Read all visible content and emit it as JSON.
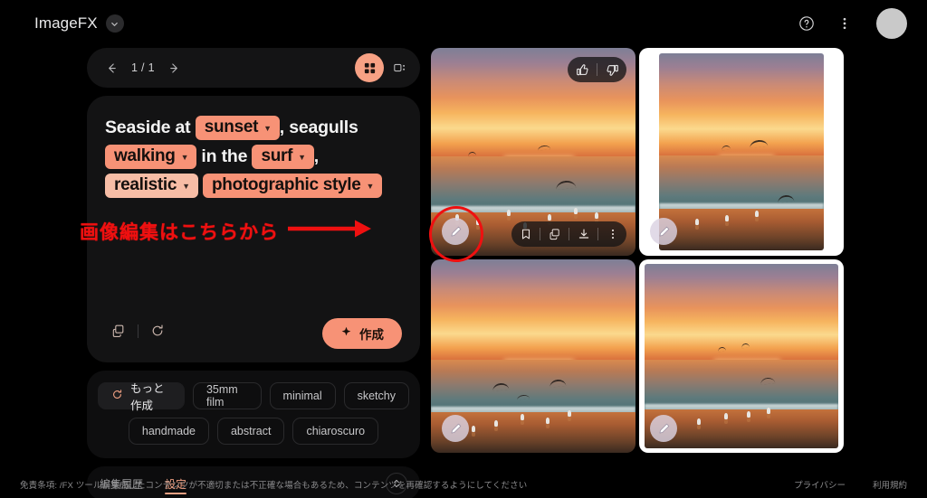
{
  "header": {
    "brand": "ImageFX",
    "brand_caret_icon": "chevron-down-icon",
    "help_icon": "help-circle-icon",
    "menu_icon": "more-vertical-icon",
    "avatar_icon": "avatar"
  },
  "pager": {
    "prev_icon": "arrow-left-icon",
    "next_icon": "arrow-right-icon",
    "count": "1 / 1",
    "grid_view_icon": "grid-view-icon",
    "detail_view_icon": "detail-view-icon"
  },
  "prompt": {
    "segments": [
      {
        "type": "text",
        "value": "Seaside at "
      },
      {
        "type": "chip",
        "value": "sunset",
        "style": "solid"
      },
      {
        "type": "text",
        "value": ", seagulls"
      },
      {
        "type": "chip",
        "value": "walking",
        "style": "solid"
      },
      {
        "type": "text",
        "value": " in the "
      },
      {
        "type": "chip",
        "value": "surf",
        "style": "solid"
      },
      {
        "type": "text",
        "value": ","
      },
      {
        "type": "chip",
        "value": "realistic",
        "style": "light"
      },
      {
        "type": "chip",
        "value": "photographic style",
        "style": "solid"
      }
    ],
    "line1_prefix": "Seaside at ",
    "chip_sunset": "sunset",
    "line1_suffix": ", seagulls",
    "chip_walking": "walking",
    "line2_mid": " in the ",
    "chip_surf": "surf",
    "line2_suffix": ",",
    "chip_realistic": "realistic",
    "chip_photographic": "photographic style",
    "copy_icon": "copy-icon",
    "reset_icon": "refresh-icon",
    "create_label": "作成",
    "create_icon": "sparkle-icon"
  },
  "suggestions": {
    "row1": [
      {
        "label": "もっと作成",
        "icon": "refresh-icon",
        "primary": true
      },
      {
        "label": "35mm film",
        "icon": "",
        "primary": false
      },
      {
        "label": "minimal",
        "icon": "",
        "primary": false
      },
      {
        "label": "sketchy",
        "icon": "",
        "primary": false
      }
    ],
    "row2": [
      {
        "label": "handmade",
        "icon": "",
        "primary": false
      },
      {
        "label": "abstract",
        "icon": "",
        "primary": false
      },
      {
        "label": "chiaroscuro",
        "icon": "",
        "primary": false
      }
    ]
  },
  "tabs": {
    "items": [
      {
        "label": "編集履歴",
        "active": false
      },
      {
        "label": "設定",
        "active": true
      }
    ],
    "expand_icon": "expand-vertical-icon"
  },
  "gallery": {
    "images": [
      {
        "alt": "Seaside at sunset with seagulls walking in the surf",
        "selected": true,
        "letterboxed": false,
        "edit_icon": "pencil-icon",
        "vote": {
          "up_icon": "thumb-up-icon",
          "down_icon": "thumb-down-icon"
        },
        "actions": [
          {
            "icon": "bookmark-icon"
          },
          {
            "icon": "copy-icon"
          },
          {
            "icon": "download-icon"
          },
          {
            "icon": "more-vertical-icon"
          }
        ]
      },
      {
        "alt": "Seagull flying over sunset shoreline",
        "selected": false,
        "letterboxed": true,
        "edit_icon": "pencil-icon"
      },
      {
        "alt": "Sunset beach with seagulls at waterline",
        "selected": false,
        "letterboxed": false,
        "edit_icon": "pencil-icon"
      },
      {
        "alt": "Seagulls on wet sand at golden sunset",
        "selected": false,
        "letterboxed": true,
        "edit_icon": "pencil-icon"
      }
    ]
  },
  "annotation": {
    "text": "画像編集はこちらから",
    "arrow_icon": "arrow-right-icon",
    "highlight_color": "#ef1010"
  },
  "footer": {
    "disclaimer": "免責条項: /FX ツールが生成したコンテンツが不適切または不正確な場合もあるため、コンテンツを再確認するようにしてください",
    "links": [
      "プライバシー",
      "利用規約"
    ]
  },
  "colors": {
    "accent": "#f79276",
    "accent_light": "#f7bda6",
    "tab_active": "#f0a183",
    "background": "#000000",
    "panel": "#131314",
    "annotation": "#ef1010"
  }
}
